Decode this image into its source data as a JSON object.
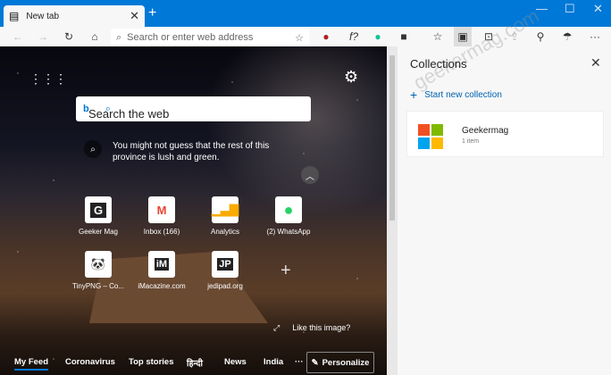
{
  "browser": {
    "tab_title": "New tab",
    "address_placeholder": "Search or enter web address"
  },
  "newtab": {
    "search_placeholder": "Search the web",
    "hint": "You might not guess that the rest of this province is lush and green.",
    "tiles": [
      {
        "label": "Geeker Mag",
        "glyph": "G"
      },
      {
        "label": "Inbox (166)",
        "glyph": "M"
      },
      {
        "label": "Analytics",
        "glyph": "▮"
      },
      {
        "label": "(2) WhatsApp",
        "glyph": "✆"
      },
      {
        "label": "TinyPNG – Co...",
        "glyph": "🐼"
      },
      {
        "label": "iMacazine.com",
        "glyph": "iM"
      },
      {
        "label": "jedipad.org",
        "glyph": "JP"
      }
    ],
    "like": "Like this image?",
    "feed": [
      "My Feed",
      "Coronavirus",
      "Top stories",
      "हिन्दी",
      "News",
      "India",
      "···"
    ],
    "personalize": "Personalize"
  },
  "collections": {
    "title": "Collections",
    "start": "Start new collection",
    "items": [
      {
        "name": "Geekermag",
        "count": "1 item"
      }
    ],
    "watermark": "geekermag.com"
  },
  "colors": {
    "accent": "#0078d7"
  }
}
